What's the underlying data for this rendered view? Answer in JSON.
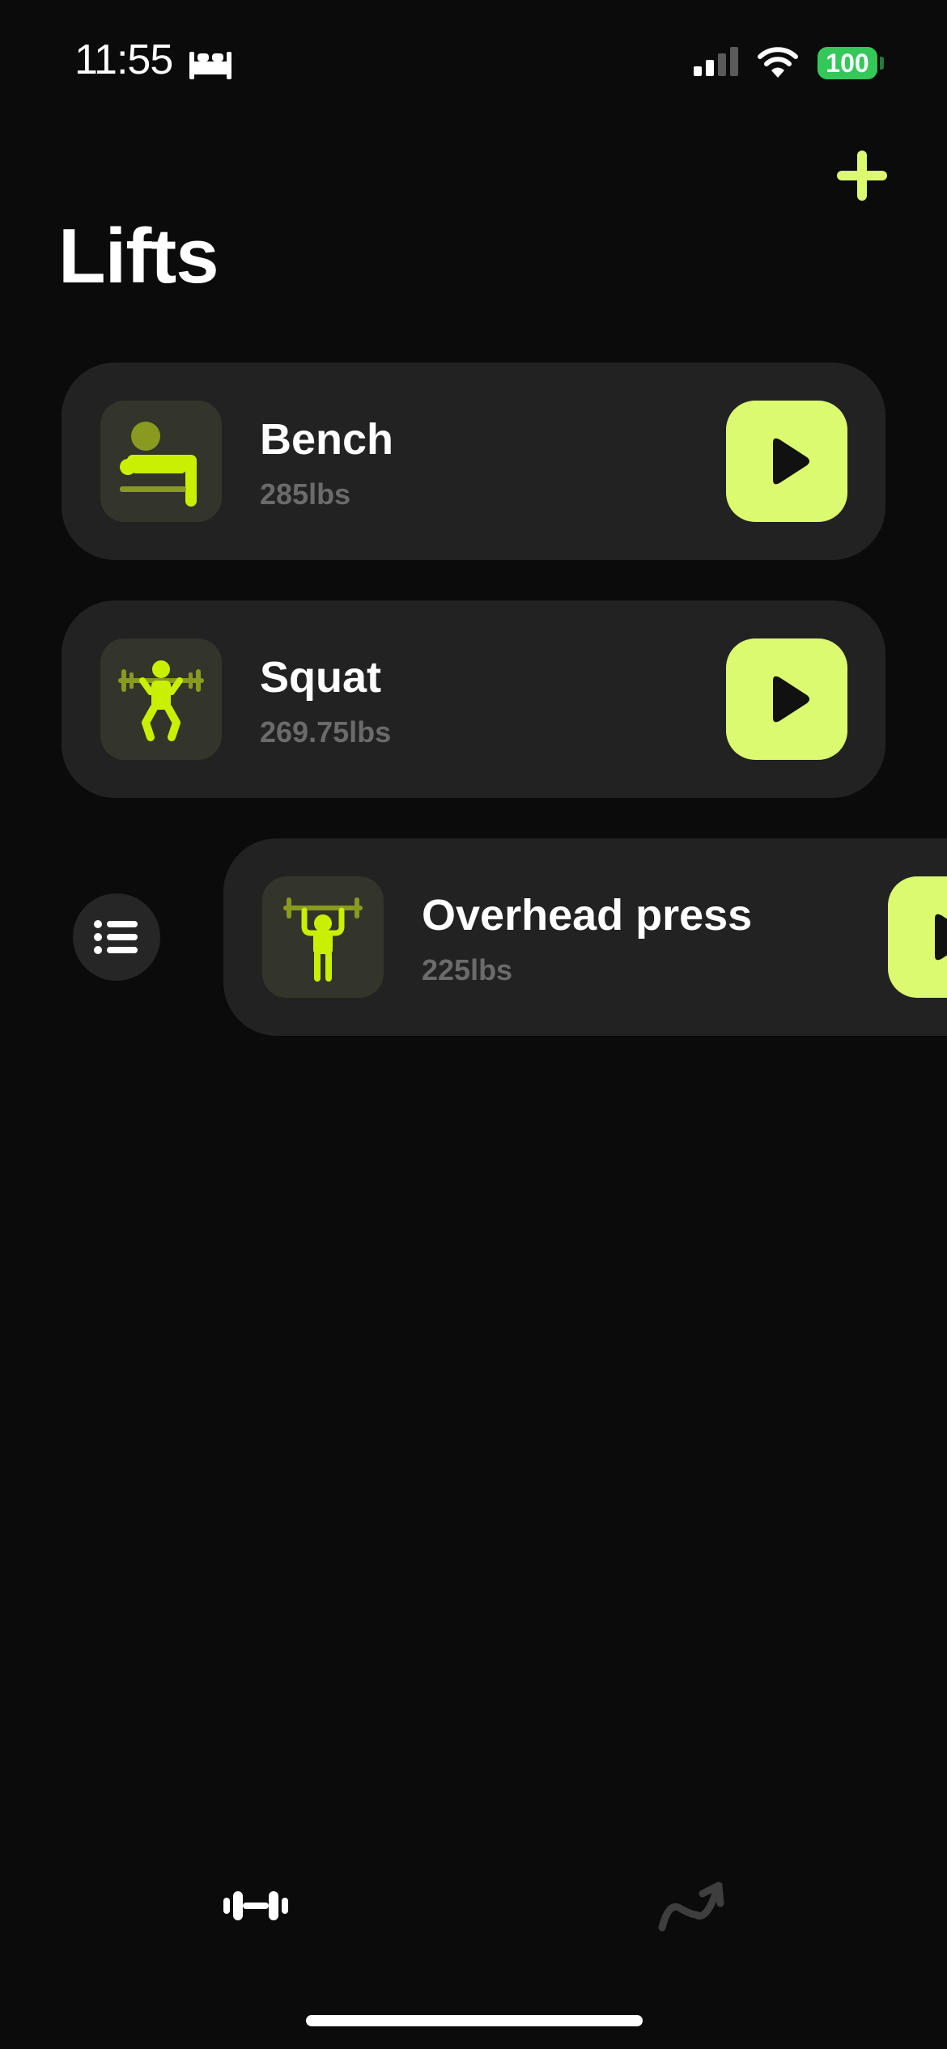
{
  "status_bar": {
    "time": "11:55",
    "battery": "100",
    "icons": [
      "bed-icon",
      "cellular-signal-icon",
      "wifi-icon",
      "battery-icon"
    ]
  },
  "header": {
    "title": "Lifts",
    "add_icon": "plus-icon"
  },
  "lifts": [
    {
      "name": "Bench",
      "weight": "285lbs",
      "icon": "bench-press-icon"
    },
    {
      "name": "Squat",
      "weight": "269.75lbs",
      "icon": "squat-icon"
    },
    {
      "name": "Overhead press",
      "weight": "225lbs",
      "icon": "overhead-press-icon"
    }
  ],
  "reorder_icon": "list-icon",
  "tab_bar": {
    "tabs": [
      {
        "id": "lifts",
        "icon": "dumbbell-icon",
        "active": true
      },
      {
        "id": "progress",
        "icon": "trend-arrow-icon",
        "active": false
      }
    ]
  },
  "colors": {
    "background": "#0b0b0b",
    "card": "#222222",
    "accent": "#dcfa70",
    "icon_lime": "#c8f000",
    "icon_olive": "#8a9a20",
    "muted_text": "#6b6b6b",
    "battery": "#34c759"
  }
}
